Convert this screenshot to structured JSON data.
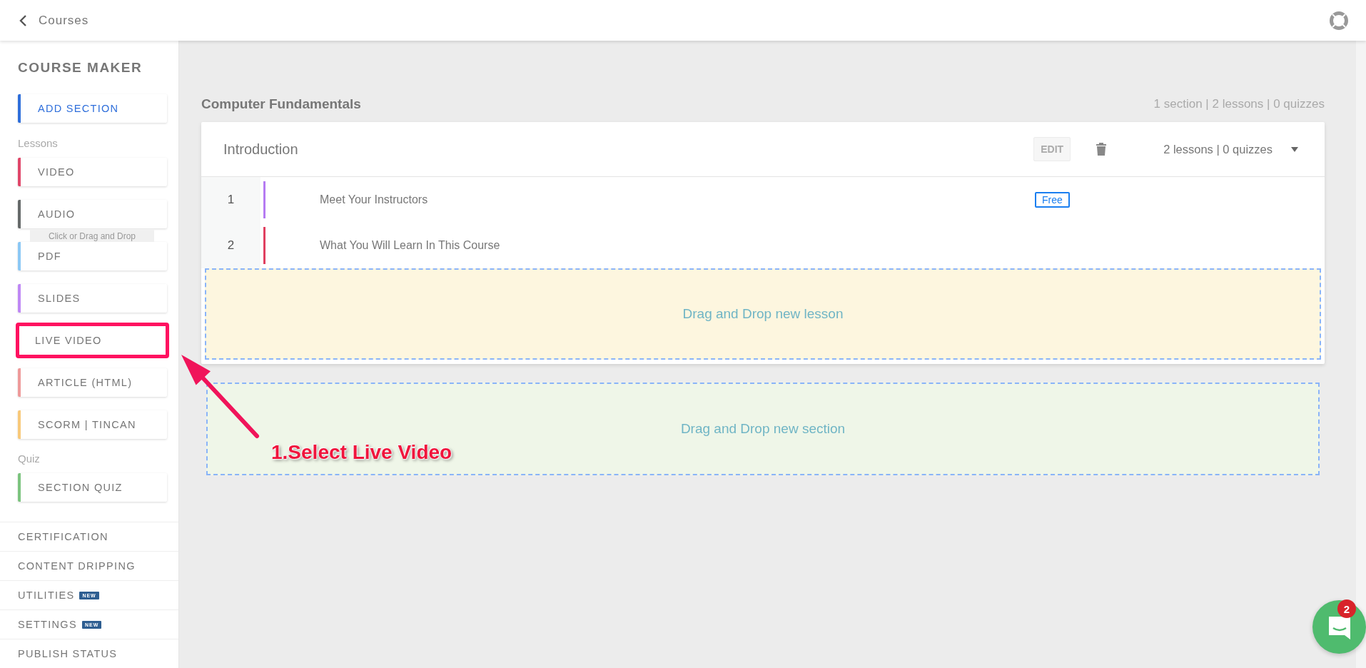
{
  "header": {
    "back_label": "Courses"
  },
  "sidebar": {
    "title": "COURSE MAKER",
    "add_section": {
      "label": "ADD SECTION",
      "color": "#2f6fdb"
    },
    "lessons_heading": "Lessons",
    "lessons": [
      {
        "label": "VIDEO",
        "color": "#e0476a",
        "highlighted": false
      },
      {
        "label": "AUDIO",
        "color": "#666a6a",
        "highlighted": false
      },
      {
        "label": "PDF",
        "color": "#8cc8f5",
        "highlighted": false
      },
      {
        "label": "SLIDES",
        "color": "#bf88f5",
        "highlighted": false
      },
      {
        "label": "LIVE VIDEO",
        "color": "#ff1060",
        "highlighted": true
      },
      {
        "label": "ARTICLE (HTML)",
        "color": "#ee9a9a",
        "highlighted": false
      },
      {
        "label": "SCORM | TINCAN",
        "color": "#f8c97a",
        "highlighted": false
      }
    ],
    "tooltip": "Click or Drag and Drop",
    "quiz_heading": "Quiz",
    "quiz": [
      {
        "label": "SECTION QUIZ",
        "color": "#7cc47f",
        "highlighted": false
      }
    ],
    "nav": [
      {
        "label": "CERTIFICATION"
      },
      {
        "label": "CONTENT DRIPPING"
      },
      {
        "label": "UTILITIES",
        "badge": "NEW"
      },
      {
        "label": "SETTINGS",
        "badge": "NEW"
      },
      {
        "label": "PUBLISH STATUS"
      }
    ]
  },
  "course": {
    "title": "Computer Fundamentals",
    "stats": "1 section | 2 lessons | 0 quizzes",
    "section": {
      "title": "Introduction",
      "edit_label": "EDIT",
      "stats": "2 lessons | 0 quizzes",
      "lessons": [
        {
          "number": "1",
          "title": "Meet Your Instructors",
          "color": "#b57bf2",
          "badge": "Free"
        },
        {
          "number": "2",
          "title": "What You Will Learn In This Course",
          "color": "#e04060"
        }
      ],
      "drop_lesson": "Drag and Drop new lesson"
    },
    "drop_section": "Drag and Drop new section"
  },
  "annotation": {
    "text": "1.Select Live Video"
  },
  "chat": {
    "unread": "2"
  }
}
